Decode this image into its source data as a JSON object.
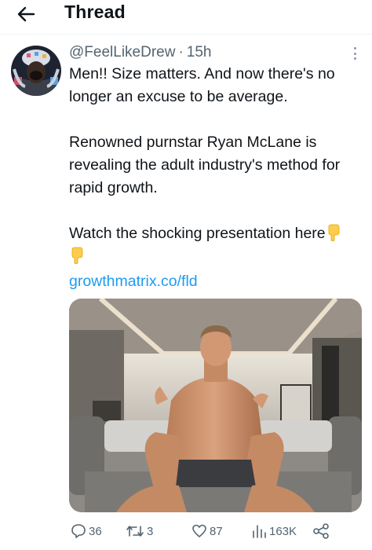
{
  "header": {
    "title": "Thread",
    "back_icon": "arrow-left-icon"
  },
  "tweet": {
    "handle": "@FeelLikeDrew",
    "time": "15h",
    "paragraphs": [
      "Men!! Size matters. And now there's no longer an excuse to be average.",
      "Renowned purnstar Ryan McLane is revealing the adult industry's method for rapid growth.",
      "Watch the shocking presentation here"
    ],
    "emoji": "pointing-down-hand-icon",
    "link": "growthmatrix.co/fld"
  },
  "actions": {
    "replies": "36",
    "retweets": "3",
    "likes": "87",
    "views": "163K"
  },
  "colors": {
    "link": "#1d9bf0",
    "muted": "#536471",
    "text": "#0f1419",
    "emoji": "#ffcc4d"
  }
}
